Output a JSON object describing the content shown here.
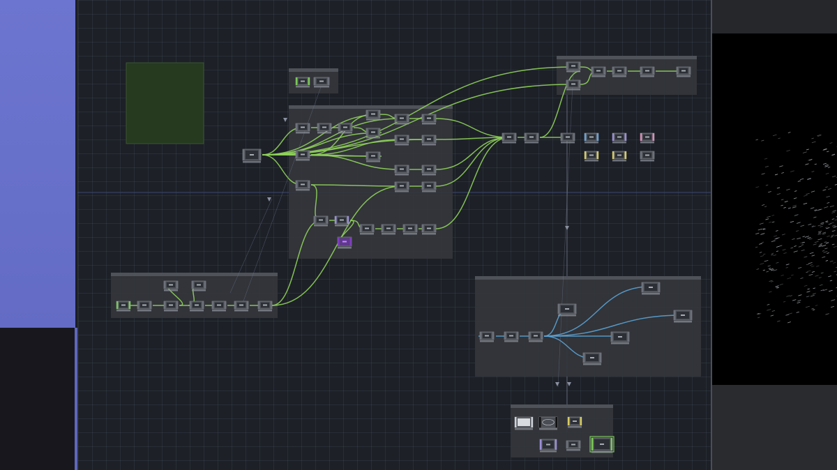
{
  "app": {
    "name": "",
    "left_panel": {
      "color": "#6c75cf"
    }
  },
  "editor": {
    "annotation": {
      "lines": []
    },
    "boxes": [
      {
        "id": "b1",
        "title": ""
      },
      {
        "id": "b2",
        "title": ""
      },
      {
        "id": "b3",
        "title": ""
      },
      {
        "id": "b4",
        "title": ""
      },
      {
        "id": "b5",
        "title": ""
      },
      {
        "id": "b6",
        "title": ""
      }
    ],
    "node_labels": {}
  },
  "viewer": {
    "content": "particle-sphere-render"
  },
  "colors": {
    "wire_green": "#8fd35a",
    "wire_blue": "#5aa3d6",
    "node_body": "#6d717a",
    "node_green": "#7cc85a",
    "node_purple": "#9b8fd8",
    "node_blue": "#6aa2d8",
    "node_pink": "#d58fb7",
    "node_yellow": "#d8cc62",
    "annotation_bg": "#253a1f"
  }
}
